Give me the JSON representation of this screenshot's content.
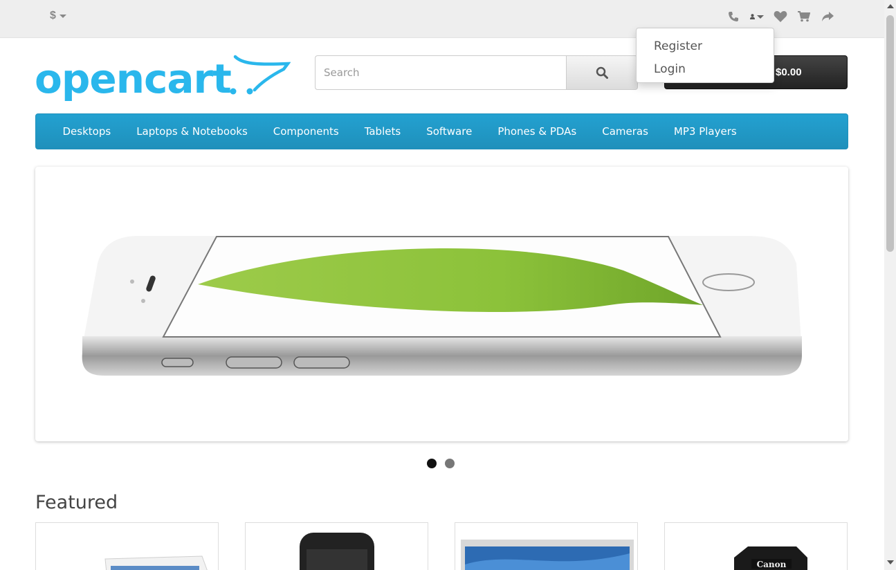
{
  "topbar": {
    "currency_symbol": "$"
  },
  "account_menu": {
    "items": [
      {
        "label": "Register"
      },
      {
        "label": "Login"
      }
    ]
  },
  "header": {
    "logo_text": "opencart",
    "search_placeholder": "Search",
    "cart_total": "$0.00"
  },
  "nav": {
    "items": [
      {
        "label": "Desktops"
      },
      {
        "label": "Laptops & Notebooks"
      },
      {
        "label": "Components"
      },
      {
        "label": "Tablets"
      },
      {
        "label": "Software"
      },
      {
        "label": "Phones & PDAs"
      },
      {
        "label": "Cameras"
      },
      {
        "label": "MP3 Players"
      }
    ]
  },
  "slideshow": {
    "slide_count": 2,
    "active_index": 0
  },
  "featured": {
    "title": "Featured"
  },
  "colors": {
    "brand": "#23a1d1",
    "topbar": "#eeeeee",
    "cart_button": "#333333"
  }
}
